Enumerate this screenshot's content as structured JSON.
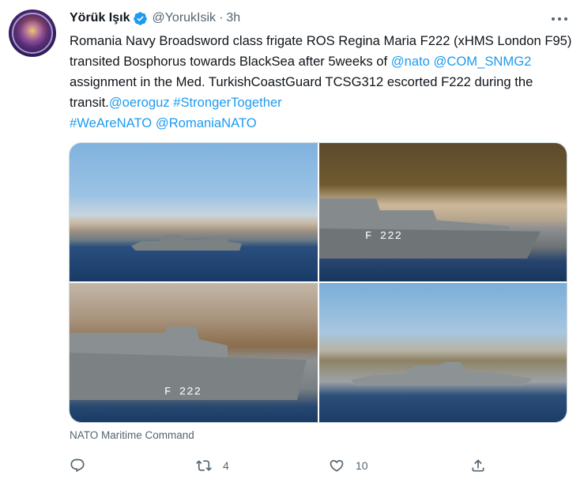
{
  "tweet": {
    "display_name": "Yörük Işık",
    "handle": "@YorukIsik",
    "separator": "·",
    "time": "3h",
    "text": {
      "part1": "Romania Navy Broadsword class frigate ROS Regina Maria F222 (xHMS London F95) transited Bosphorus towards BlackSea after 5weeks of ",
      "mention_nato": "@nato",
      "part2": " ",
      "mention_snmg2": "@COM_SNMG2",
      "part3": " assignment in the Med. TurkishCoastGuard TCSG312 escorted F222 during the transit.",
      "mention_oeroguz": "@oeroguz",
      "part4": " ",
      "hashtag_stronger": "#StrongerTogether",
      "part5": " ",
      "hashtag_wearenato": "#WeAreNATO",
      "part6": " ",
      "mention_romanianato": "@RomaniaNATO"
    },
    "photos": [
      {
        "hull_number": ""
      },
      {
        "hull_number": "F 222"
      },
      {
        "hull_number": "F 222"
      },
      {
        "hull_number": ""
      }
    ],
    "media_caption": "NATO Maritime Command",
    "actions": {
      "reply_count": "",
      "retweet_count": "4",
      "like_count": "10"
    }
  },
  "colors": {
    "link": "#1d9bf0",
    "secondary_text": "#536471",
    "verified": "#1d9bf0"
  },
  "icons": {
    "verified": "verified-badge-icon",
    "more": "more-options-icon",
    "reply": "reply-icon",
    "retweet": "retweet-icon",
    "like": "heart-icon",
    "share": "share-icon"
  }
}
